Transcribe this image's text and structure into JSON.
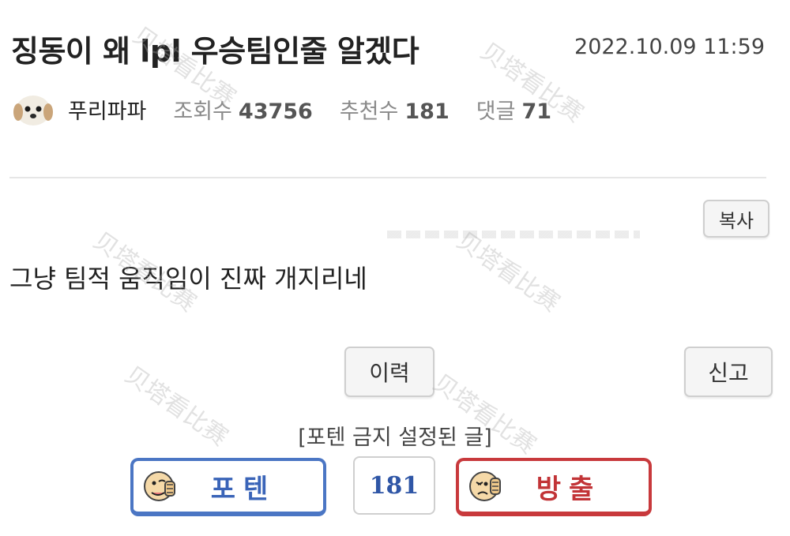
{
  "post": {
    "title": "징동이 왜 lpl 우승팀인줄 알겠다",
    "date": "2022.10.09 11:59",
    "author": "푸리파파",
    "views_label": "조회수",
    "views": "43756",
    "recommend_label": "추천수",
    "recommend": "181",
    "comments_label": "댓글",
    "comments": "71",
    "body": "그냥 팀적 움직임이 진짜 개지리네"
  },
  "actions": {
    "copy": "복사",
    "history": "이력",
    "report": "신고"
  },
  "vote": {
    "notice": "[포텐 금지 설정된 글]",
    "up_label": "포텐",
    "count": "181",
    "down_label": "방출",
    "up_color": "#4b76c4",
    "down_color": "#c8393c"
  },
  "watermark": "贝塔看比赛"
}
